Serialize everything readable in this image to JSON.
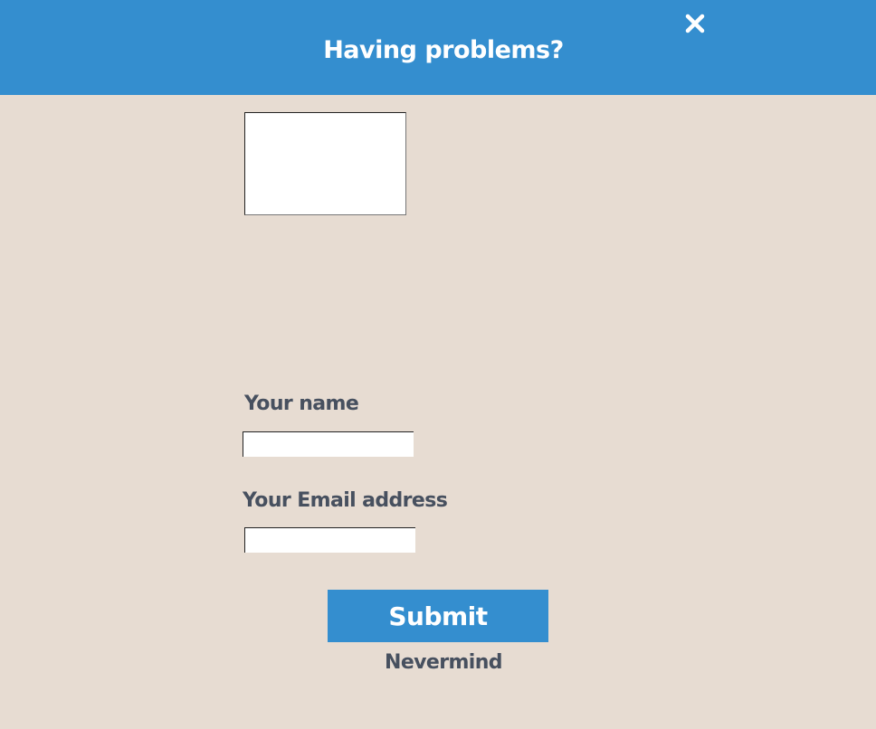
{
  "header": {
    "title": "Having problems?",
    "close_icon": "close-icon"
  },
  "form": {
    "message": {
      "value": "",
      "placeholder": ""
    },
    "name": {
      "label": "Your name",
      "value": "",
      "placeholder": ""
    },
    "email": {
      "label": "Your Email address",
      "value": "",
      "placeholder": ""
    },
    "submit_label": "Submit",
    "nevermind_label": "Nevermind"
  },
  "colors": {
    "header_bg": "#348ecf",
    "page_bg": "#e7dcd2",
    "label_text": "#47505f",
    "button_bg": "#348ecf",
    "button_text": "#ffffff"
  }
}
